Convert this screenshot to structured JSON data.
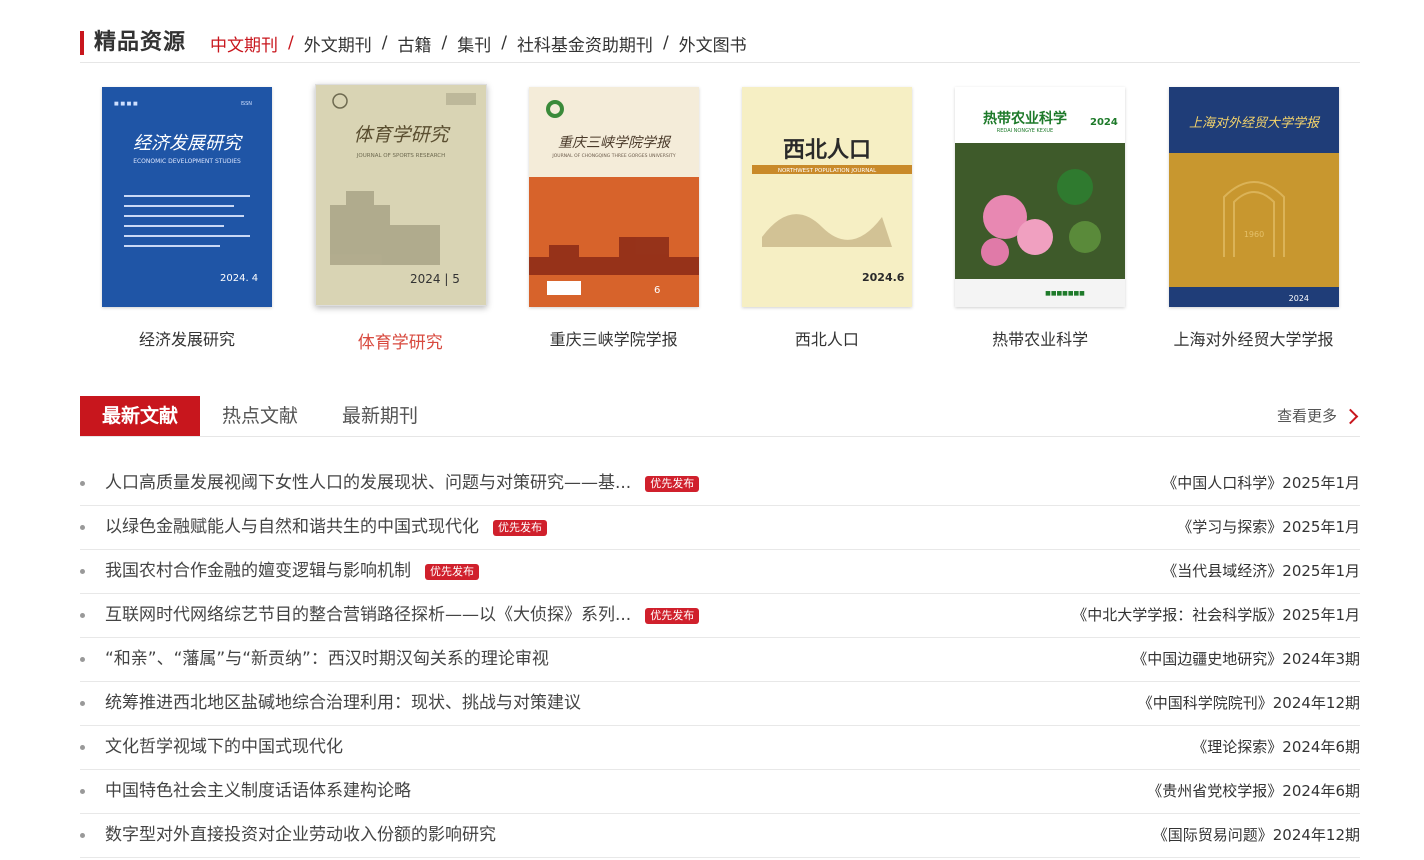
{
  "section": {
    "title": "精品资源",
    "tabs": [
      {
        "label": "中文期刊",
        "active": true
      },
      {
        "label": "外文期刊",
        "active": false
      },
      {
        "label": "古籍",
        "active": false
      },
      {
        "label": "集刊",
        "active": false
      },
      {
        "label": "社科基金资助期刊",
        "active": false
      },
      {
        "label": "外文图书",
        "active": false
      }
    ],
    "separator": "/"
  },
  "journals": [
    {
      "name": "经济发展研究",
      "cover_color": "#1f55a6",
      "cover_title": "经济发展研究",
      "cover_subtitle": "ECONOMIC DEVELOPMENT STUDIES",
      "cover_issue": "2024. 4"
    },
    {
      "name": "体育学研究",
      "cover_color": "#d9d4b4",
      "cover_title": "体育学研究",
      "cover_subtitle": "JOURNAL OF SPORTS RESEARCH",
      "cover_issue": "2024 | 5"
    },
    {
      "name": "重庆三峡学院学报",
      "cover_color": "#d7632b",
      "cover_title": "重庆三峡学院学报",
      "cover_subtitle": "JOURNAL OF CHONGQING THREE GORGES UNIVERSITY",
      "cover_issue": "6"
    },
    {
      "name": "西北人口",
      "cover_color": "#f6efc4",
      "cover_title": "西北人口",
      "cover_subtitle": "NORTHWEST POPULATION JOURNAL",
      "cover_issue": "2024.6"
    },
    {
      "name": "热带农业科学",
      "cover_color": "#ffffff",
      "cover_title": "热带农业科学",
      "cover_subtitle": "REDAI NONGYE KEXUE",
      "cover_issue": "2024"
    },
    {
      "name": "上海对外经贸大学学报",
      "cover_color": "#c8972f",
      "cover_title": "上海对外经贸大学学报",
      "cover_subtitle": "1960",
      "cover_issue": "2024"
    }
  ],
  "highlighted_journal": 1,
  "literature": {
    "tabs": [
      {
        "label": "最新文献",
        "active": true
      },
      {
        "label": "热点文献",
        "active": false
      },
      {
        "label": "最新期刊",
        "active": false
      }
    ],
    "more_label": "查看更多",
    "badge_label": "优先发布",
    "articles": [
      {
        "title": "人口高质量发展视阈下女性人口的发展现状、问题与对策研究——基...",
        "badge": true,
        "source": "《中国人口科学》2025年1月"
      },
      {
        "title": "以绿色金融赋能人与自然和谐共生的中国式现代化",
        "badge": true,
        "source": "《学习与探索》2025年1月"
      },
      {
        "title": "我国农村合作金融的嬗变逻辑与影响机制",
        "badge": true,
        "source": "《当代县域经济》2025年1月"
      },
      {
        "title": "互联网时代网络综艺节目的整合营销路径探析——以《大侦探》系列...",
        "badge": true,
        "source": "《中北大学学报：社会科学版》2025年1月"
      },
      {
        "title": "“和亲”、“藩属”与“新贡纳”：西汉时期汉匈关系的理论审视",
        "badge": false,
        "source": "《中国边疆史地研究》2024年3期"
      },
      {
        "title": "统筹推进西北地区盐碱地综合治理利用：现状、挑战与对策建议",
        "badge": false,
        "source": "《中国科学院院刊》2024年12期"
      },
      {
        "title": "文化哲学视域下的中国式现代化",
        "badge": false,
        "source": "《理论探索》2024年6期"
      },
      {
        "title": "中国特色社会主义制度话语体系建构论略",
        "badge": false,
        "source": "《贵州省党校学报》2024年6期"
      },
      {
        "title": "数字型对外直接投资对企业劳动收入份额的影响研究",
        "badge": false,
        "source": "《国际贸易问题》2024年12期"
      }
    ]
  }
}
